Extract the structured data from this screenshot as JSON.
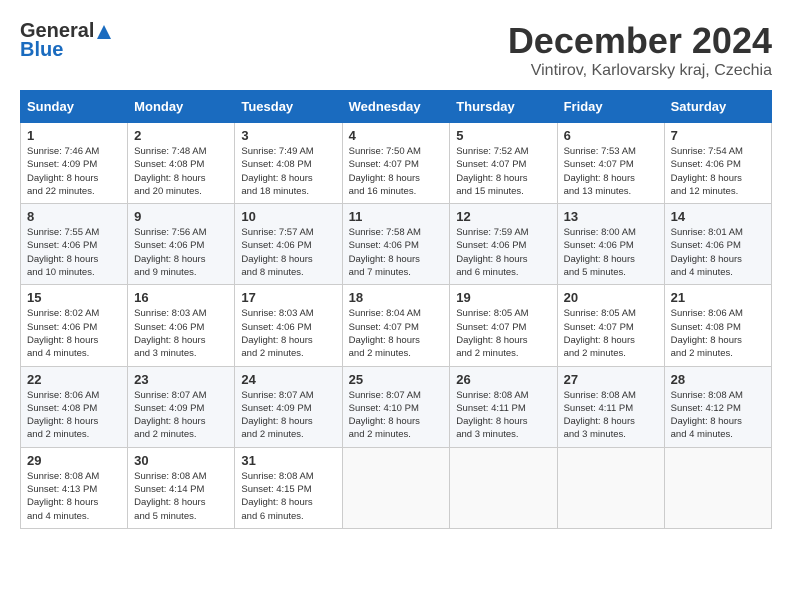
{
  "header": {
    "logo_general": "General",
    "logo_blue": "Blue",
    "month_title": "December 2024",
    "location": "Vintirov, Karlovarsky kraj, Czechia"
  },
  "weekdays": [
    "Sunday",
    "Monday",
    "Tuesday",
    "Wednesday",
    "Thursday",
    "Friday",
    "Saturday"
  ],
  "weeks": [
    [
      {
        "day": "1",
        "info": "Sunrise: 7:46 AM\nSunset: 4:09 PM\nDaylight: 8 hours\nand 22 minutes."
      },
      {
        "day": "2",
        "info": "Sunrise: 7:48 AM\nSunset: 4:08 PM\nDaylight: 8 hours\nand 20 minutes."
      },
      {
        "day": "3",
        "info": "Sunrise: 7:49 AM\nSunset: 4:08 PM\nDaylight: 8 hours\nand 18 minutes."
      },
      {
        "day": "4",
        "info": "Sunrise: 7:50 AM\nSunset: 4:07 PM\nDaylight: 8 hours\nand 16 minutes."
      },
      {
        "day": "5",
        "info": "Sunrise: 7:52 AM\nSunset: 4:07 PM\nDaylight: 8 hours\nand 15 minutes."
      },
      {
        "day": "6",
        "info": "Sunrise: 7:53 AM\nSunset: 4:07 PM\nDaylight: 8 hours\nand 13 minutes."
      },
      {
        "day": "7",
        "info": "Sunrise: 7:54 AM\nSunset: 4:06 PM\nDaylight: 8 hours\nand 12 minutes."
      }
    ],
    [
      {
        "day": "8",
        "info": "Sunrise: 7:55 AM\nSunset: 4:06 PM\nDaylight: 8 hours\nand 10 minutes."
      },
      {
        "day": "9",
        "info": "Sunrise: 7:56 AM\nSunset: 4:06 PM\nDaylight: 8 hours\nand 9 minutes."
      },
      {
        "day": "10",
        "info": "Sunrise: 7:57 AM\nSunset: 4:06 PM\nDaylight: 8 hours\nand 8 minutes."
      },
      {
        "day": "11",
        "info": "Sunrise: 7:58 AM\nSunset: 4:06 PM\nDaylight: 8 hours\nand 7 minutes."
      },
      {
        "day": "12",
        "info": "Sunrise: 7:59 AM\nSunset: 4:06 PM\nDaylight: 8 hours\nand 6 minutes."
      },
      {
        "day": "13",
        "info": "Sunrise: 8:00 AM\nSunset: 4:06 PM\nDaylight: 8 hours\nand 5 minutes."
      },
      {
        "day": "14",
        "info": "Sunrise: 8:01 AM\nSunset: 4:06 PM\nDaylight: 8 hours\nand 4 minutes."
      }
    ],
    [
      {
        "day": "15",
        "info": "Sunrise: 8:02 AM\nSunset: 4:06 PM\nDaylight: 8 hours\nand 4 minutes."
      },
      {
        "day": "16",
        "info": "Sunrise: 8:03 AM\nSunset: 4:06 PM\nDaylight: 8 hours\nand 3 minutes."
      },
      {
        "day": "17",
        "info": "Sunrise: 8:03 AM\nSunset: 4:06 PM\nDaylight: 8 hours\nand 2 minutes."
      },
      {
        "day": "18",
        "info": "Sunrise: 8:04 AM\nSunset: 4:07 PM\nDaylight: 8 hours\nand 2 minutes."
      },
      {
        "day": "19",
        "info": "Sunrise: 8:05 AM\nSunset: 4:07 PM\nDaylight: 8 hours\nand 2 minutes."
      },
      {
        "day": "20",
        "info": "Sunrise: 8:05 AM\nSunset: 4:07 PM\nDaylight: 8 hours\nand 2 minutes."
      },
      {
        "day": "21",
        "info": "Sunrise: 8:06 AM\nSunset: 4:08 PM\nDaylight: 8 hours\nand 2 minutes."
      }
    ],
    [
      {
        "day": "22",
        "info": "Sunrise: 8:06 AM\nSunset: 4:08 PM\nDaylight: 8 hours\nand 2 minutes."
      },
      {
        "day": "23",
        "info": "Sunrise: 8:07 AM\nSunset: 4:09 PM\nDaylight: 8 hours\nand 2 minutes."
      },
      {
        "day": "24",
        "info": "Sunrise: 8:07 AM\nSunset: 4:09 PM\nDaylight: 8 hours\nand 2 minutes."
      },
      {
        "day": "25",
        "info": "Sunrise: 8:07 AM\nSunset: 4:10 PM\nDaylight: 8 hours\nand 2 minutes."
      },
      {
        "day": "26",
        "info": "Sunrise: 8:08 AM\nSunset: 4:11 PM\nDaylight: 8 hours\nand 3 minutes."
      },
      {
        "day": "27",
        "info": "Sunrise: 8:08 AM\nSunset: 4:11 PM\nDaylight: 8 hours\nand 3 minutes."
      },
      {
        "day": "28",
        "info": "Sunrise: 8:08 AM\nSunset: 4:12 PM\nDaylight: 8 hours\nand 4 minutes."
      }
    ],
    [
      {
        "day": "29",
        "info": "Sunrise: 8:08 AM\nSunset: 4:13 PM\nDaylight: 8 hours\nand 4 minutes."
      },
      {
        "day": "30",
        "info": "Sunrise: 8:08 AM\nSunset: 4:14 PM\nDaylight: 8 hours\nand 5 minutes."
      },
      {
        "day": "31",
        "info": "Sunrise: 8:08 AM\nSunset: 4:15 PM\nDaylight: 8 hours\nand 6 minutes."
      },
      {
        "day": "",
        "info": ""
      },
      {
        "day": "",
        "info": ""
      },
      {
        "day": "",
        "info": ""
      },
      {
        "day": "",
        "info": ""
      }
    ]
  ]
}
